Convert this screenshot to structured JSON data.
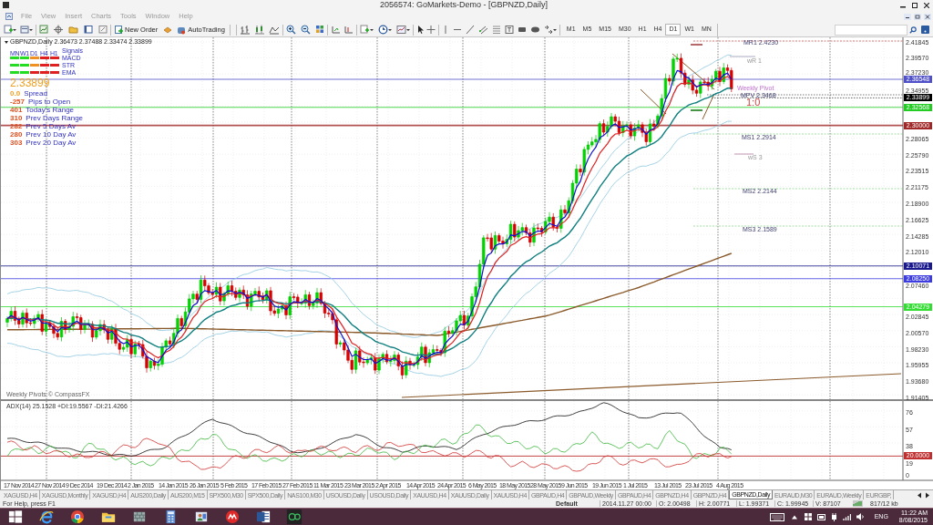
{
  "window": {
    "title": "2056574: GoMarkets-Demo - [GBPNZD,Daily]"
  },
  "menu": [
    "File",
    "View",
    "Insert",
    "Charts",
    "Tools",
    "Window",
    "Help"
  ],
  "toolbar": {
    "buttons": [
      {
        "label": "New Order"
      },
      {
        "label": "AutoTrading"
      }
    ],
    "timeframes": [
      {
        "label": "M1",
        "selected": false
      },
      {
        "label": "M5",
        "selected": false
      },
      {
        "label": "M15",
        "selected": false
      },
      {
        "label": "M30",
        "selected": false
      },
      {
        "label": "H1",
        "selected": false
      },
      {
        "label": "H4",
        "selected": false
      },
      {
        "label": "D1",
        "selected": true
      },
      {
        "label": "W1",
        "selected": false
      },
      {
        "label": "MN",
        "selected": false
      }
    ]
  },
  "chart": {
    "header": "GBPNZD,Daily 2.36473 2.37488 2.33474 2.33899",
    "signals": {
      "columns": [
        "MN",
        "W1",
        "D1",
        "H4",
        "H1"
      ],
      "title": "Signals",
      "rows": [
        {
          "label": "MACD",
          "cells": [
            {
              "color": "#22dd22"
            },
            {
              "color": "#22dd22"
            },
            {
              "color": "#f09020"
            },
            {
              "color": "#e02020"
            },
            {
              "color": "#e02020"
            }
          ]
        },
        {
          "label": "STR",
          "cells": [
            {
              "color": "#22dd22"
            },
            {
              "color": "#22dd22"
            },
            {
              "color": "#f09020"
            },
            {
              "color": "#e02020"
            },
            {
              "color": "#e02020"
            }
          ]
        },
        {
          "label": "EMA",
          "cells": [
            {
              "color": "#22dd22"
            },
            {
              "color": "#22dd22"
            },
            {
              "color": "#e02020"
            },
            {
              "color": "#e02020"
            },
            {
              "color": "#e02020"
            }
          ]
        }
      ]
    },
    "price": "2.33899",
    "stats": [
      {
        "reading": "0.0",
        "name": "Spread",
        "color": "#f0a020"
      },
      {
        "reading": "-257",
        "name": "Pips to Open",
        "color": "#e05020"
      },
      {
        "reading": "401",
        "name": "Today's Range",
        "color": "#e05020"
      },
      {
        "reading": "310",
        "name": "Prev Days Range",
        "color": "#e05020"
      },
      {
        "reading": "282",
        "name": "Prev 5 Days Av",
        "color": "#e05020"
      },
      {
        "reading": "280",
        "name": "Prev 10 Day Av",
        "color": "#e05020"
      },
      {
        "reading": "303",
        "name": "Prev 20 Day Av",
        "color": "#e05020"
      }
    ],
    "pivots": [
      {
        "label": "MR1 2.4230",
        "kind": "monthly"
      },
      {
        "label": "wR 1",
        "kind": "weekly"
      },
      {
        "label": "Weekly Pivot",
        "kind": "weekly_pivot"
      },
      {
        "label": "MPV 2.3468",
        "kind": "monthly"
      },
      {
        "label": "1:0",
        "kind": "ratio"
      },
      {
        "label": "MS1 2.2914",
        "kind": "monthly"
      },
      {
        "label": "wS 3",
        "kind": "weekly"
      },
      {
        "label": "MS2 2.2144",
        "kind": "monthly"
      },
      {
        "label": "MS3 2.1589",
        "kind": "monthly"
      }
    ],
    "price_axis": [
      "2.41845",
      "2.39570",
      "2.37230",
      "2.34955",
      "2.28065",
      "2.25790",
      "2.23515",
      "2.21175",
      "2.18900",
      "2.16625",
      "2.14285",
      "2.12010",
      "2.07460",
      "2.02845",
      "2.00570",
      "1.98230",
      "1.95955",
      "1.93680",
      "1.91405"
    ],
    "price_levels": [
      {
        "label": "2.36548",
        "color": "#5050c8",
        "kind": "line"
      },
      {
        "label": "2.33899",
        "color": "#000000",
        "kind": "current"
      },
      {
        "label": "2.32568",
        "color": "#22cc22",
        "kind": "line"
      },
      {
        "label": "2.30000",
        "color": "#a02828",
        "kind": "line"
      },
      {
        "label": "2.10071",
        "color": "#1a1a8c",
        "kind": "line"
      },
      {
        "label": "2.08250",
        "color": "#3c3ce0",
        "kind": "line"
      },
      {
        "label": "2.04279",
        "color": "#33dd33",
        "kind": "line"
      }
    ],
    "footer": "Weekly Pivots © CompassFX"
  },
  "indicator": {
    "title": "ADX(14) 25.1528 +DI:19.5567 -DI:21.4266",
    "axis": [
      "76",
      "57",
      "38",
      "19",
      "0"
    ],
    "level": {
      "label": "20.0000",
      "color": "#c03030"
    }
  },
  "dates": [
    "17 Nov 2014",
    "27 Nov 2014",
    "9 Dec 2014",
    "19 Dec 2014",
    "2 Jan 2015",
    "14 Jan 2015",
    "26 Jan 2015",
    "5 Feb 2015",
    "17 Feb 2015",
    "27 Feb 2015",
    "11 Mar 2015",
    "23 Mar 2015",
    "2 Apr 2015",
    "14 Apr 2015",
    "24 Apr 2015",
    "6 May 2015",
    "18 May 2015",
    "28 May 2015",
    "9 Jun 2015",
    "19 Jun 2015",
    "1 Jul 2015",
    "13 Jul 2015",
    "23 Jul 2015",
    "4 Aug 2015"
  ],
  "tabs": [
    {
      "label": "XAGUSD,H4",
      "selected": false
    },
    {
      "label": "XAGUSD,Monthly",
      "selected": false
    },
    {
      "label": "XAGUSD,H4",
      "selected": false
    },
    {
      "label": "AUS200,Daily",
      "selected": false
    },
    {
      "label": "AUS200,M15",
      "selected": false
    },
    {
      "label": "SPX500,M30",
      "selected": false
    },
    {
      "label": "SPX500,Daily",
      "selected": false
    },
    {
      "label": "NAS100,M30",
      "selected": false
    },
    {
      "label": "USOUSD,Daily",
      "selected": false
    },
    {
      "label": "USOUSD,Daily",
      "selected": false
    },
    {
      "label": "XAUUSD,H4",
      "selected": false
    },
    {
      "label": "XAUUSD,Daily",
      "selected": false
    },
    {
      "label": "XAUUSD,H4",
      "selected": false
    },
    {
      "label": "GBPAUD,H4",
      "selected": false
    },
    {
      "label": "GBPAUD,Weekly",
      "selected": false
    },
    {
      "label": "GBPAUD,H4",
      "selected": false
    },
    {
      "label": "GBPNZD,H4",
      "selected": false
    },
    {
      "label": "GBPNZD,H4",
      "selected": false
    },
    {
      "label": "GBPNZD,Daily",
      "selected": true
    },
    {
      "label": "EURAUD,M30",
      "selected": false
    },
    {
      "label": "EURAUD,Weekly",
      "selected": false
    },
    {
      "label": "EURGBP,",
      "selected": false
    }
  ],
  "status_bar": {
    "help": "For Help, press F1",
    "profile": "Default",
    "fields": [
      "2014.11.27 00:00",
      "O: 2.00498",
      "H: 2.00771",
      "L: 1.99371",
      "C: 1.99945",
      "V: 87107"
    ],
    "size": "817/12 kb"
  },
  "taskbar": {
    "apps": [
      {
        "kind": "start"
      },
      {
        "kind": "ie"
      },
      {
        "kind": "chrome"
      },
      {
        "kind": "explorer"
      },
      {
        "kind": "grid"
      },
      {
        "kind": "calculator"
      },
      {
        "kind": "people"
      },
      {
        "kind": "red"
      },
      {
        "kind": "word"
      },
      {
        "kind": "go"
      }
    ],
    "language": "ENG",
    "time": "11:22 AM",
    "date": "8/08/2015"
  }
}
